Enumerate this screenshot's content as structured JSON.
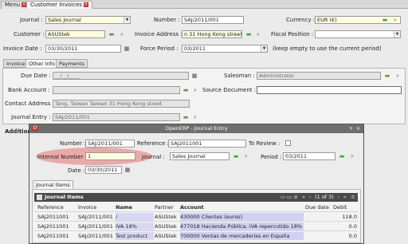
{
  "tabs": {
    "menu": "Menu",
    "customer_invoices": "Customer Invoices"
  },
  "invoice": {
    "journal_label": "Journal :",
    "journal_value": "Sales Journal",
    "number_label": "Number :",
    "number_value": "SAJ/2011/001",
    "currency_label": "Currency :",
    "currency_value": "EUR (€)",
    "customer_label": "Customer :",
    "customer_value": "ASUStek",
    "invoice_address_label": "Invoice Address :",
    "invoice_address_value": "n 31 Hong Kong street",
    "fiscal_position_label": "Fiscal Position :",
    "fiscal_position_value": "",
    "invoice_date_label": "Invoice Date :",
    "invoice_date_value": "03/30/2011",
    "force_period_label": "Force Period :",
    "force_period_value": "03/2011",
    "force_period_hint": "(keep empty to use the current period)"
  },
  "notebook": {
    "tab_invoice": "Invoice",
    "tab_other_info": "Other Info",
    "tab_payments": "Payments"
  },
  "other_info": {
    "due_date_label": "Due Date :",
    "due_date_value": "__/__/____",
    "salesman_label": "Salesman :",
    "salesman_value": "Administrator",
    "bank_account_label": "Bank Account :",
    "bank_account_value": "",
    "source_document_label": "Source Document :",
    "source_document_value": "",
    "contact_address_label": "Contact Address :",
    "contact_address_value": "Tang, Taiwan Taiwan 31 Hong Kong street",
    "journal_entry_label": "Journal Entry :",
    "journal_entry_value": "SAJ/2011/001",
    "additional_label": "Addition"
  },
  "dialog": {
    "title": "OpenERP - Journal Entry",
    "logo": "O",
    "ctrl_add": "+",
    "ctrl_close": "×",
    "number_label": "Number :",
    "number_value": "SAJ/2011/001",
    "reference_label": "Reference :",
    "reference_value": "SAJ2011001",
    "to_review_label": "To Review :",
    "internal_number_label": "Internal Number :",
    "internal_number_value": "1",
    "journal_label": "Journal :",
    "journal_value": "Sales Journal",
    "period_label": "Period :",
    "period_value": "03/2011",
    "date_label": "Date :",
    "date_value": "03/30/2011",
    "tab_journal_items": "Journal Items",
    "grid_title": "Journal Items",
    "pager": "(1 of 3)",
    "columns": [
      "Reference",
      "Invoice",
      "Name",
      "Partner",
      "Account",
      "Due date",
      "Debit"
    ],
    "rows": [
      {
        "reference": "SAJ2011001",
        "invoice": "SAJ/2011/001",
        "name": "/",
        "partner": "ASUStek",
        "account": "430000 Clientes (euros)",
        "due_date": "",
        "debit": "118.0"
      },
      {
        "reference": "SAJ2011001",
        "invoice": "SAJ/2011/001",
        "name": "IVA 18%",
        "partner": "ASUStek",
        "account": "477018 Hacienda Pública. IVA repercutido 18%",
        "due_date": "",
        "debit": "0.0"
      },
      {
        "reference": "SAJ2011001",
        "invoice": "SAJ/2011/001",
        "name": "Test product",
        "partner": "ASUStek",
        "account": "700000 Ventas de mercaderías en España",
        "due_date": "",
        "debit": "0.0"
      }
    ]
  },
  "colors": {
    "highlight": "#e97373",
    "required_field": "#fcfce0",
    "dialog_titlebar": "#6e6e6e",
    "grid_header": "#4a4a4a",
    "selected_cells": "#d0d0f2"
  }
}
